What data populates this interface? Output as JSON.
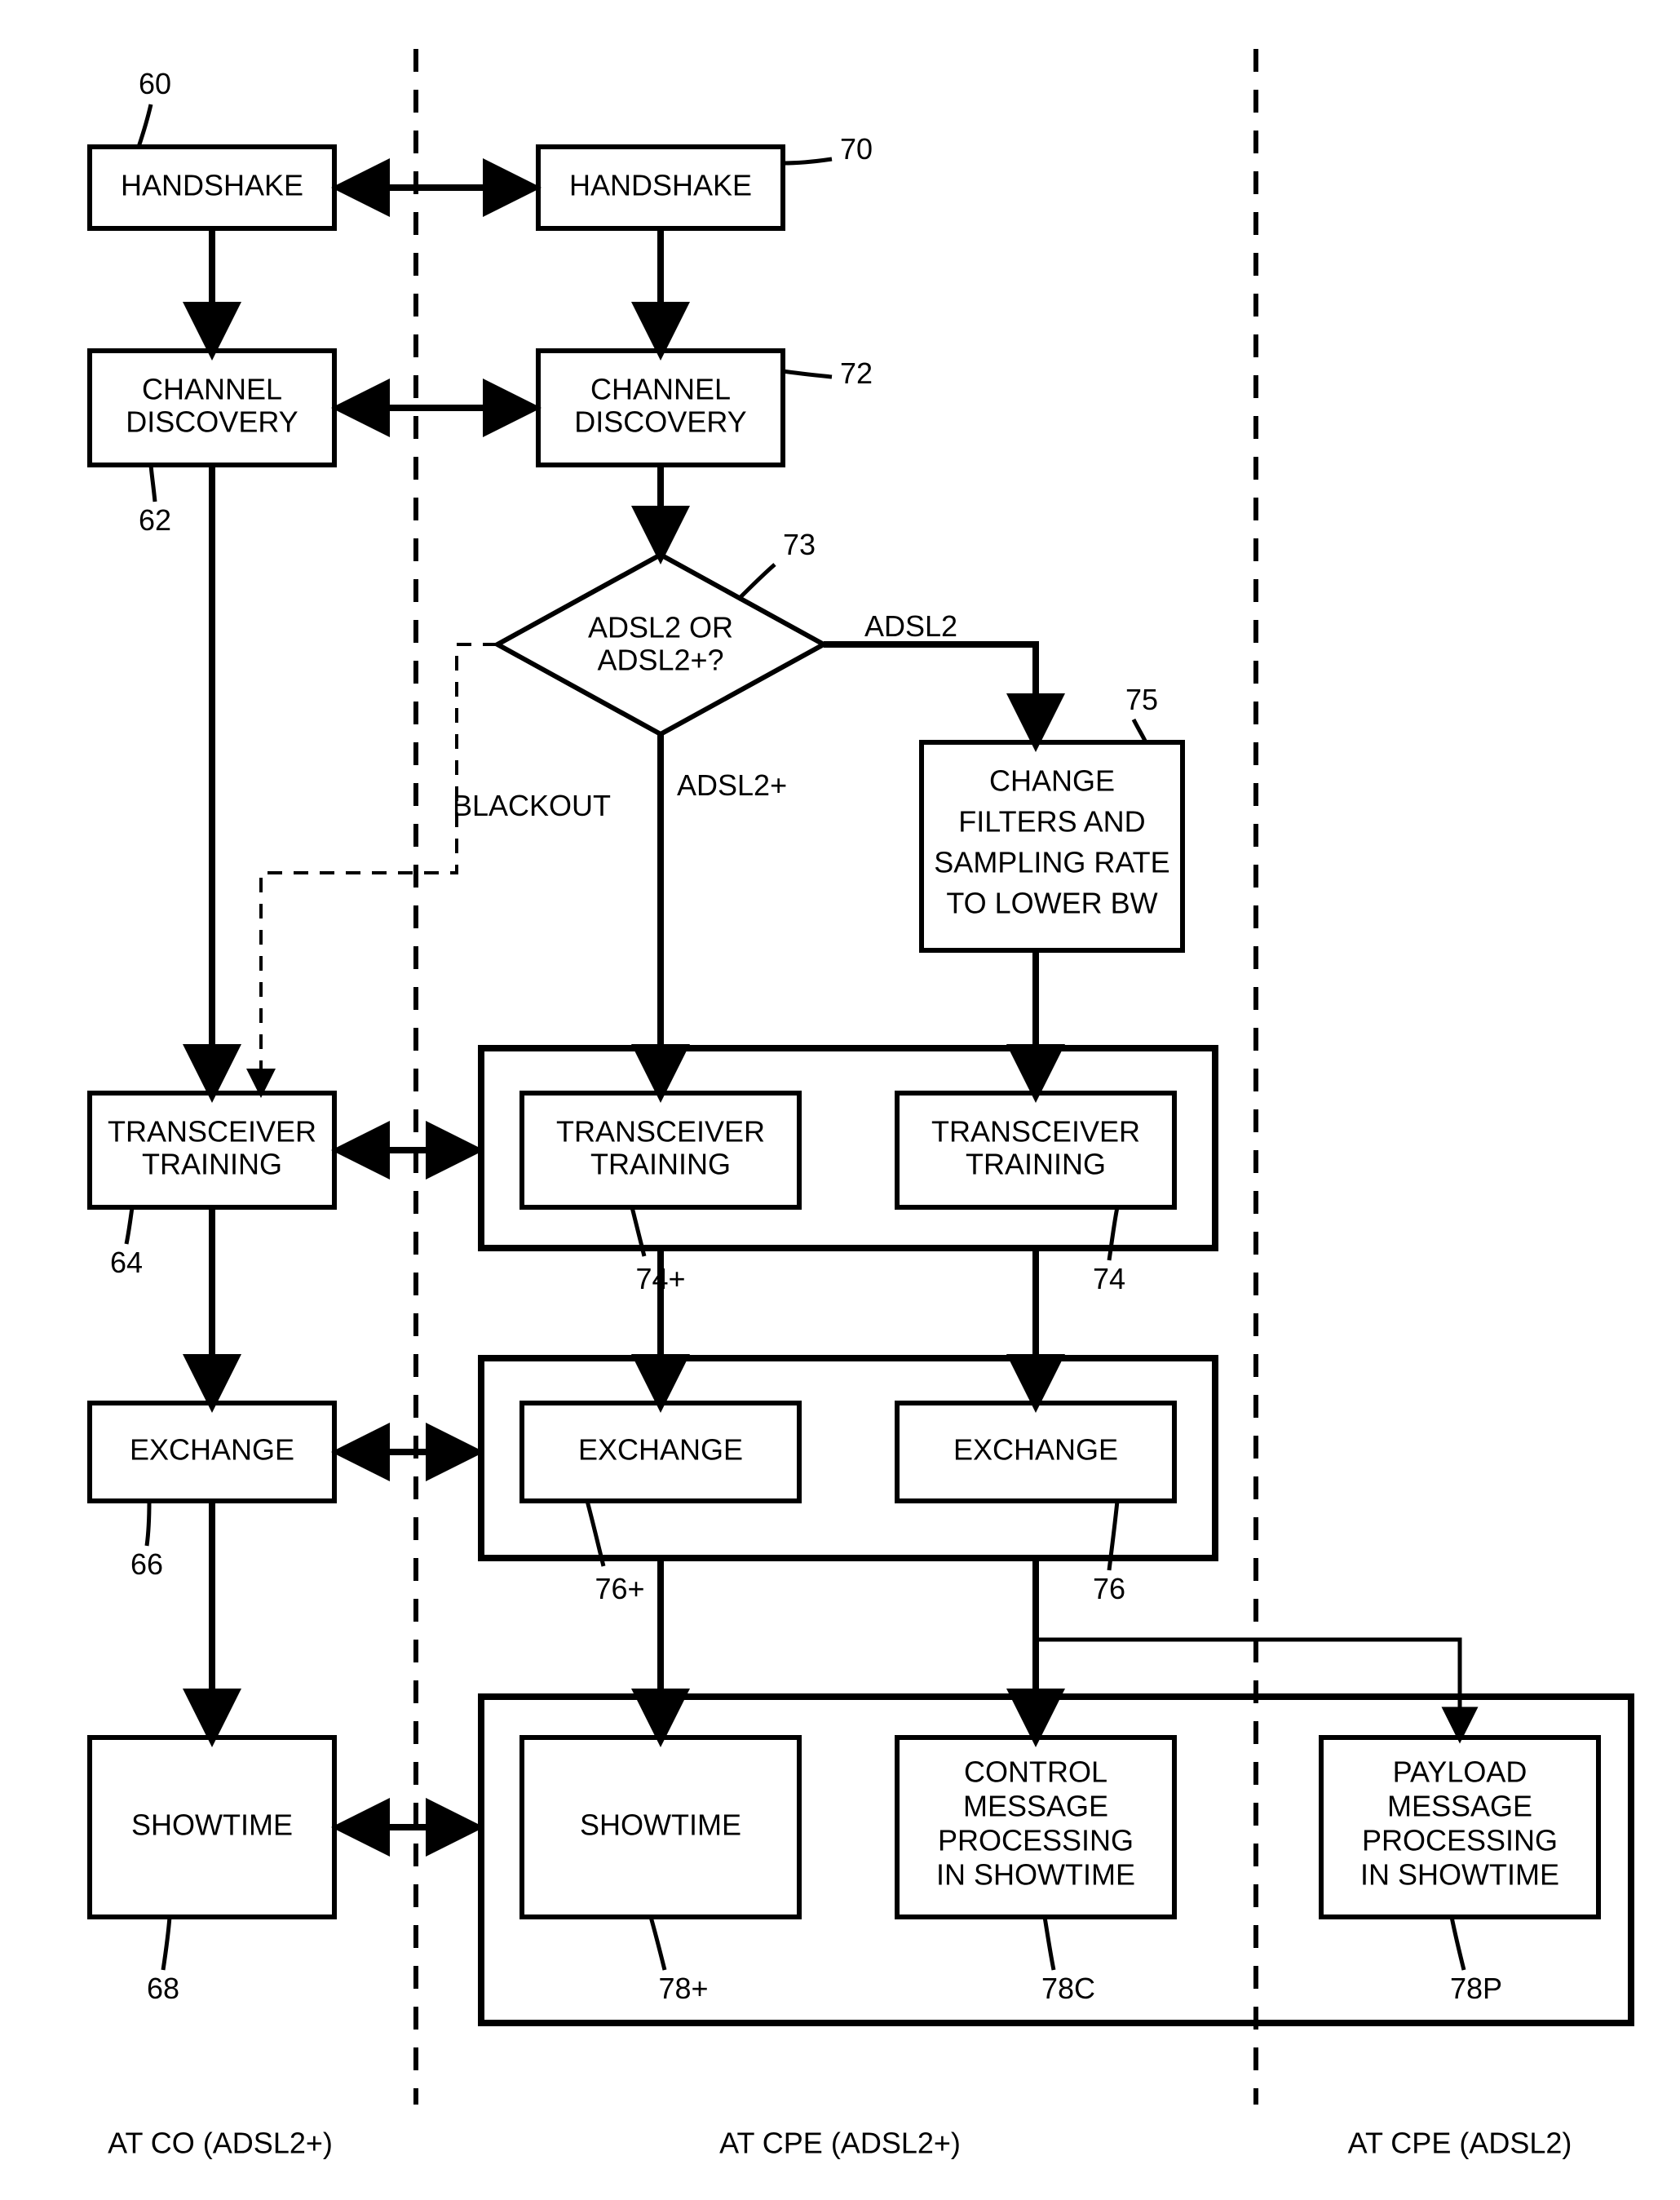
{
  "refs": {
    "r60": "60",
    "r62": "62",
    "r64": "64",
    "r66": "66",
    "r68": "68",
    "r70": "70",
    "r72": "72",
    "r73": "73",
    "r74p": "74+",
    "r74": "74",
    "r75": "75",
    "r76p": "76+",
    "r76": "76",
    "r78p": "78+",
    "r78c": "78C",
    "r78p2": "78P"
  },
  "boxes": {
    "handshake_co": "HANDSHAKE",
    "handshake_cpe": "HANDSHAKE",
    "channel_co_l1": "CHANNEL",
    "channel_co_l2": "DISCOVERY",
    "channel_cpe_l1": "CHANNEL",
    "channel_cpe_l2": "DISCOVERY",
    "decision_l1": "ADSL2 OR",
    "decision_l2": "ADSL2+?",
    "change_l1": "CHANGE",
    "change_l2": "FILTERS AND",
    "change_l3": "SAMPLING RATE",
    "change_l4": "TO LOWER BW",
    "trans_co_l1": "TRANSCEIVER",
    "trans_co_l2": "TRAINING",
    "trans_cpe1_l1": "TRANSCEIVER",
    "trans_cpe1_l2": "TRAINING",
    "trans_cpe2_l1": "TRANSCEIVER",
    "trans_cpe2_l2": "TRAINING",
    "exchange_co": "EXCHANGE",
    "exchange_cpe1": "EXCHANGE",
    "exchange_cpe2": "EXCHANGE",
    "showtime_co": "SHOWTIME",
    "showtime_cpe": "SHOWTIME",
    "ctrl_l1": "CONTROL",
    "ctrl_l2": "MESSAGE",
    "ctrl_l3": "PROCESSING",
    "ctrl_l4": "IN SHOWTIME",
    "payload_l1": "PAYLOAD",
    "payload_l2": "MESSAGE",
    "payload_l3": "PROCESSING",
    "payload_l4": "IN SHOWTIME"
  },
  "edgeLabels": {
    "adsl2": "ADSL2",
    "adsl2p": "ADSL2+",
    "blackout": "BLACKOUT"
  },
  "lanes": {
    "co": "AT CO (ADSL2+)",
    "cpe_plus": "AT CPE (ADSL2+)",
    "cpe": "AT CPE (ADSL2)"
  }
}
